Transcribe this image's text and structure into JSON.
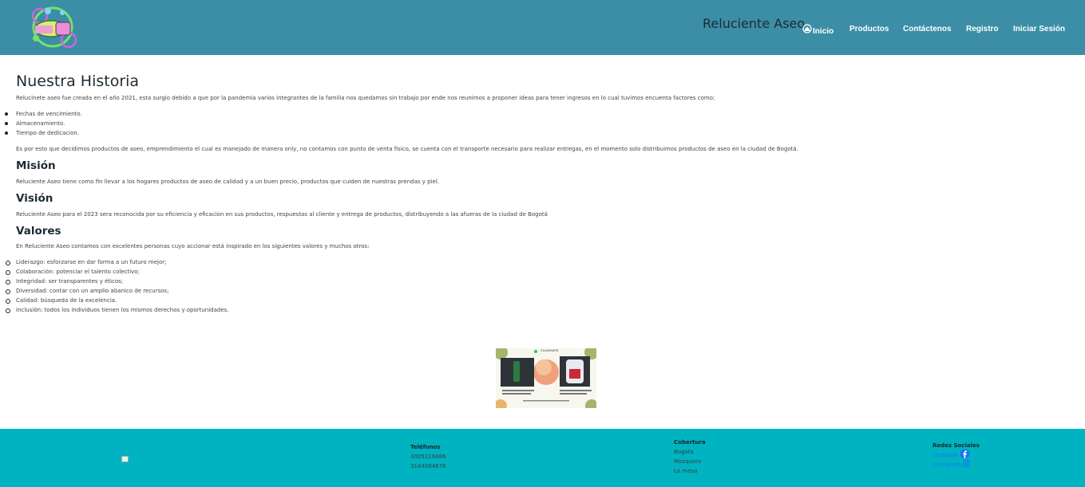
{
  "header": {
    "brand": "Reluciente Aseo",
    "nav": {
      "home": "Inicio",
      "products": "Productos",
      "contact": "Contáctenos",
      "register": "Registro",
      "login": "Iniciar Sesión"
    },
    "logo_text": "RELUCIENTE ASEO",
    "background": "#3b8ea5"
  },
  "main": {
    "title": "Nuestra Historia",
    "intro": "Relucinete aseo fue creada en el año 2021, esta surgio debido a que por la pandemia varios integrantes de la familia nos quedamos sin trabajo por ende nos reunimos a proponer ideas para tener ingresos en lo cual tuvimos encuenta factores como;",
    "factors": [
      "Fechas de vencimiento.",
      "Almacenamiento.",
      "Tiempo de dedicacion."
    ],
    "paragraph2": "Es por esto que decidimos productos de aseo, emprendimiento el cual es manejado de manera only, no contamos con punto de venta fisico, se cuenta con el transporte necesario para realizar entregas, en el momento solo distribuimos productos de aseo en la ciudad de Bogotá.",
    "mision_title": "Misión",
    "mision_text": "Reluciente Aseo tiene como fin llevar a los hogares productos de aseo de calidad y a un buen precio, productos que cuiden de nuestras prendas y piel.",
    "vision_title": "Visión",
    "vision_text": "Reluciente Aseo para el 2023 sera reconocida por su eficiencia y eficacion en sus productos, respuestas al cliente y entrega de productos, distribuyendo a las afueras de la ciudad de Bogotá",
    "valores_title": "Valores",
    "valores_intro": "En Reluciente Aseo contamos con excelentes personas cuyo accionar está inspirado en los siguientes valores y muchos otros:",
    "valores": [
      "Liderazgo: esforzarse en dar forma a un futuro mejor;",
      "Colaboración: potenciar el talento colectivo;",
      "Integridad: ser transparentes y éticos;",
      "Diversidad: contar con un amplio abanico de recursos;",
      "Calidad: búsqueda de la excelencia.",
      "Inclusión: todos los individuos tienen los mismos derechos y oportunidades."
    ],
    "flyer": {
      "phone": "3144094676"
    }
  },
  "footer": {
    "phones_title": "Teléfonos",
    "phones": [
      "3005119486",
      "3144094676"
    ],
    "coverage_title": "Cobertura",
    "coverage": [
      "Bogota",
      "Mosquera",
      "La mesa"
    ],
    "social_title": "Redes Sociales",
    "social": [
      "facebook",
      "instagram"
    ],
    "background": "#00b3c0",
    "link_color": "#1177ff"
  }
}
